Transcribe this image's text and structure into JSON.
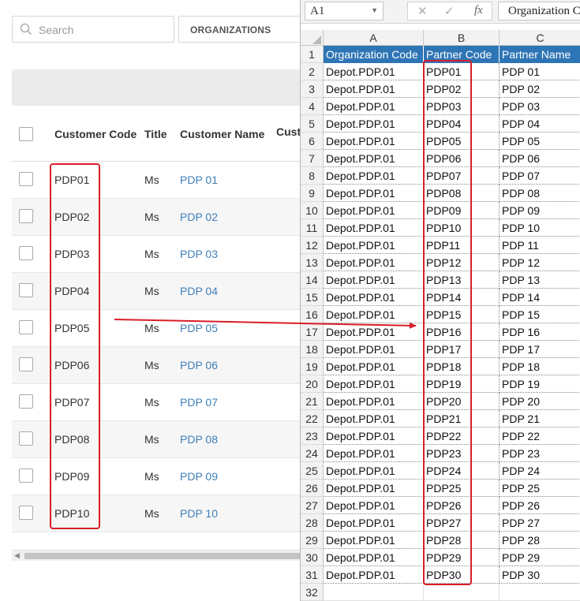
{
  "webapp": {
    "search_placeholder": "Search",
    "organizations_label": "ORGANIZATIONS",
    "columns": [
      "Customer Code",
      "Title",
      "Customer Name",
      "Cust"
    ],
    "rows": [
      {
        "code": "PDP01",
        "title": "Ms",
        "name": "PDP 01"
      },
      {
        "code": "PDP02",
        "title": "Ms",
        "name": "PDP 02"
      },
      {
        "code": "PDP03",
        "title": "Ms",
        "name": "PDP 03"
      },
      {
        "code": "PDP04",
        "title": "Ms",
        "name": "PDP 04"
      },
      {
        "code": "PDP05",
        "title": "Ms",
        "name": "PDP 05"
      },
      {
        "code": "PDP06",
        "title": "Ms",
        "name": "PDP 06"
      },
      {
        "code": "PDP07",
        "title": "Ms",
        "name": "PDP 07"
      },
      {
        "code": "PDP08",
        "title": "Ms",
        "name": "PDP 08"
      },
      {
        "code": "PDP09",
        "title": "Ms",
        "name": "PDP 09"
      },
      {
        "code": "PDP10",
        "title": "Ms",
        "name": "PDP 10"
      }
    ],
    "link_color": "#3e7eb8"
  },
  "excel": {
    "name_box": "A1",
    "formula_value": "Organization Code",
    "cancel_glyph": "✕",
    "enter_glyph": "✓",
    "fx_glyph": "fx",
    "column_letters": [
      "A",
      "B",
      "C"
    ],
    "header_row": [
      "Organization Code",
      "Partner Code",
      "Partner Name"
    ],
    "header_fill": "#2e75b6",
    "org_value": "Depot.PDP.01",
    "partner_codes": [
      "PDP01",
      "PDP02",
      "PDP03",
      "PDP04",
      "PDP05",
      "PDP06",
      "PDP07",
      "PDP08",
      "PDP09",
      "PDP10",
      "PDP11",
      "PDP12",
      "PDP13",
      "PDP14",
      "PDP15",
      "PDP16",
      "PDP17",
      "PDP18",
      "PDP19",
      "PDP20",
      "PDP21",
      "PDP22",
      "PDP23",
      "PDP24",
      "PDP25",
      "PDP26",
      "PDP27",
      "PDP28",
      "PDP29",
      "PDP30"
    ],
    "partner_names": [
      "PDP 01",
      "PDP 02",
      "PDP 03",
      "PDP 04",
      "PDP 05",
      "PDP 06",
      "PDP 07",
      "PDP 08",
      "PDP 09",
      "PDP 10",
      "PDP 11",
      "PDP 12",
      "PDP 13",
      "PDP 14",
      "PDP 15",
      "PDP 16",
      "PDP 17",
      "PDP 18",
      "PDP 19",
      "PDP 20",
      "PDP 21",
      "PDP 22",
      "PDP 23",
      "PDP 24",
      "PDP 25",
      "PDP 26",
      "PDP 27",
      "PDP 28",
      "PDP 29",
      "PDP 30"
    ],
    "last_row_number": "32"
  },
  "annotation_color": "#d91e2a"
}
